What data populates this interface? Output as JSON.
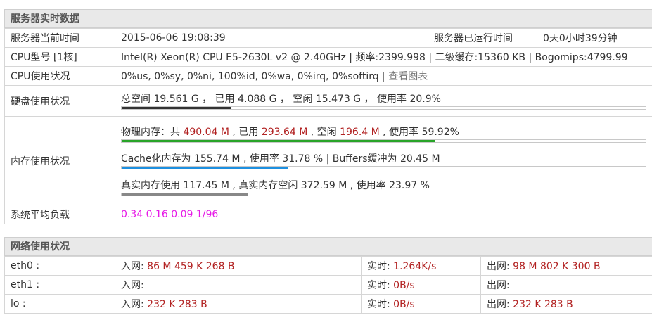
{
  "server": {
    "title": "服务器实时数据",
    "current_time_label": "服务器当前时间",
    "current_time": "2015-06-06 19:08:39",
    "uptime_label": "服务器已运行时间",
    "uptime": "0天0小时39分钟",
    "cpu_model_label": "CPU型号 [1核]",
    "cpu_model": "Intel(R) Xeon(R) CPU E5-2630L v2 @ 2.40GHz | 频率:2399.998 | 二级缓存:15360 KB | Bogomips:4799.99",
    "cpu_usage_label": "CPU使用状况",
    "cpu_usage": "0%us, 0%sy, 0%ni, 100%id, 0%wa, 0%irq, 0%softirq",
    "cpu_usage_sep": " | ",
    "cpu_chart_link": "查看图表",
    "disk_label": "硬盘使用状况",
    "disk_text": "总空间 19.561 G ， 已用 4.088 G ， 空闲 15.473 G ， 使用率 20.9%",
    "disk_pct": 20.9,
    "mem_label": "内存使用状况",
    "mem_phys": {
      "p1": "物理内存：共 ",
      "total": "490.04 M",
      "p2": " , 已用 ",
      "used": "293.64 M",
      "p3": " , 空闲 ",
      "free": "196.4 M",
      "p4": " , 使用率 ",
      "pct": 59.92,
      "pct_text": "59.92%"
    },
    "mem_cache_text": "Cache化内存为 155.74 M , 使用率 31.78 % | Buffers缓冲为 20.45 M",
    "mem_cache_pct": 31.78,
    "mem_real_text": "真实内存使用 117.45 M , 真实内存空闲 372.59 M , 使用率 23.97 %",
    "mem_real_pct": 23.97,
    "load_label": "系统平均负载",
    "load_value": "0.34 0.16 0.09 1/96"
  },
  "network": {
    "title": "网络使用状况",
    "in_label": "入网: ",
    "rt_label": "实时: ",
    "out_label": "出网: ",
    "rows": [
      {
        "name": "eth0 :",
        "in": "86 M 459 K 268 B",
        "rt": "1.264K/s",
        "out": "98 M 802 K 300 B"
      },
      {
        "name": "eth1 :",
        "in": "",
        "rt": "0B/s",
        "out": ""
      },
      {
        "name": "lo :",
        "in": "232 K 283 B",
        "rt": "0B/s",
        "out": "232 K 283 B"
      }
    ]
  },
  "colors": {
    "disk_bar": "#333333",
    "phys_bar": "#28a428",
    "cache_bar": "#1e90e0",
    "real_bar": "#888888",
    "value_red": "#b22222",
    "load_magenta": "#e619e6"
  }
}
